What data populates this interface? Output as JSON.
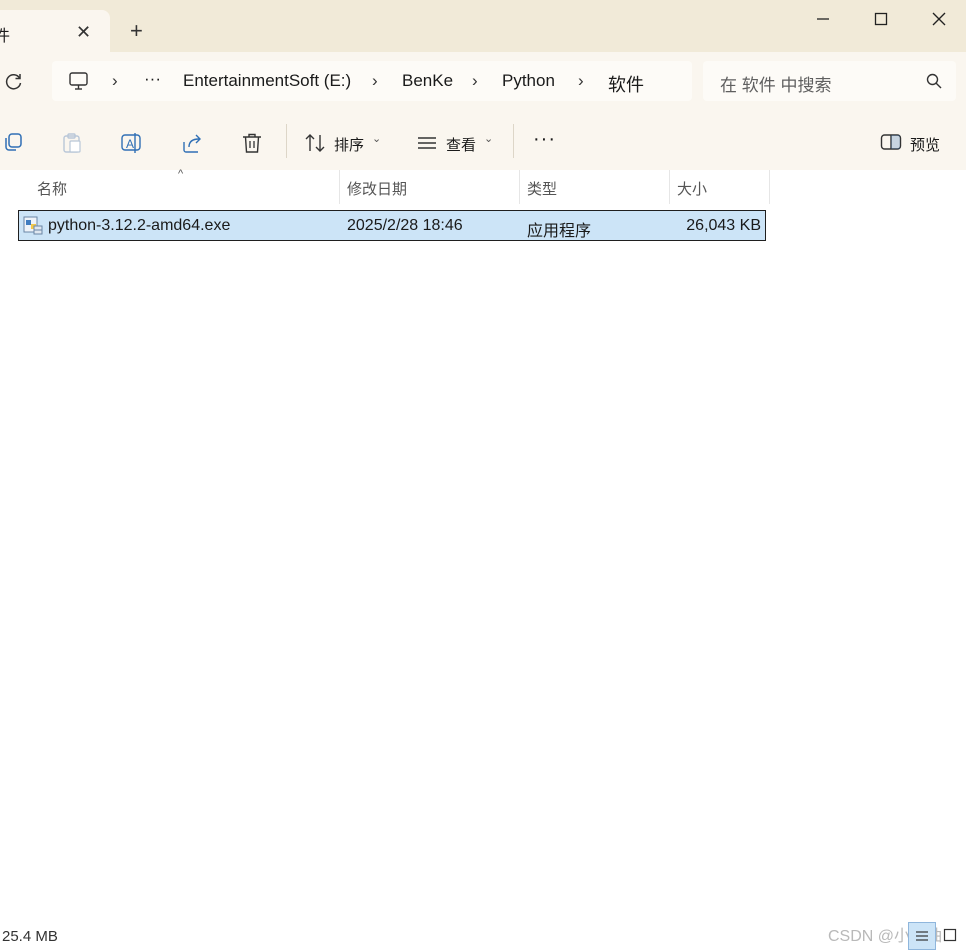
{
  "tab": {
    "title": "件",
    "close_glyph": "✕"
  },
  "new_tab_glyph": "+",
  "breadcrumb": {
    "items": [
      "EntertainmentSoft (E:)",
      "BenKe",
      "Python",
      "软件"
    ],
    "overflow": "···",
    "separator": "›"
  },
  "search": {
    "placeholder": "在 软件 中搜索"
  },
  "toolbar": {
    "sort_label": "排序",
    "view_label": "查看",
    "more_label": "···",
    "preview_label": "预览",
    "caret": "⌄"
  },
  "columns": [
    "名称",
    "修改日期",
    "类型",
    "大小"
  ],
  "sort_indicator": "^",
  "files": [
    {
      "name": "python-3.12.2-amd64.exe",
      "modified": "2025/2/28 18:46",
      "type": "应用程序",
      "size": "26,043 KB",
      "selected": true
    }
  ],
  "status": {
    "selection_size": "25.4 MB"
  },
  "watermark": "CSDN @小西柚",
  "colors": {
    "selection": "#cce4f7",
    "titlebar": "#f1ead8",
    "toolbar": "#faf6ef"
  }
}
